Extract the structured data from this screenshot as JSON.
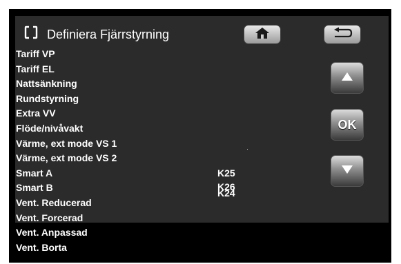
{
  "header": {
    "title": "Definiera Fjärrstyrning",
    "icon": "remote-frame-icon"
  },
  "buttons": {
    "home_icon": "home-icon",
    "back_icon": "back-arrow-icon",
    "up_icon": "up-arrow-icon",
    "ok_label": "OK",
    "down_icon": "down-arrow-icon"
  },
  "list": {
    "items": [
      "Tariff VP",
      "Tariff EL",
      "Nattsänkning",
      "Rundstyrning",
      "Extra VV",
      "Flöde/nivåvakt",
      "Värme, ext mode VS 1",
      "Värme, ext mode VS 2",
      "Smart A",
      "Smart B",
      "Vent. Reducerad",
      "Vent. Forcerad",
      "Vent. Anpassad",
      "Vent. Borta"
    ]
  },
  "values": {
    "smart_a": "K25",
    "smart_b": "K26",
    "vent_reducerad": "K24"
  },
  "colors": {
    "background": "#000000",
    "panel": "#2b2b2b",
    "text": "#ffffff"
  }
}
